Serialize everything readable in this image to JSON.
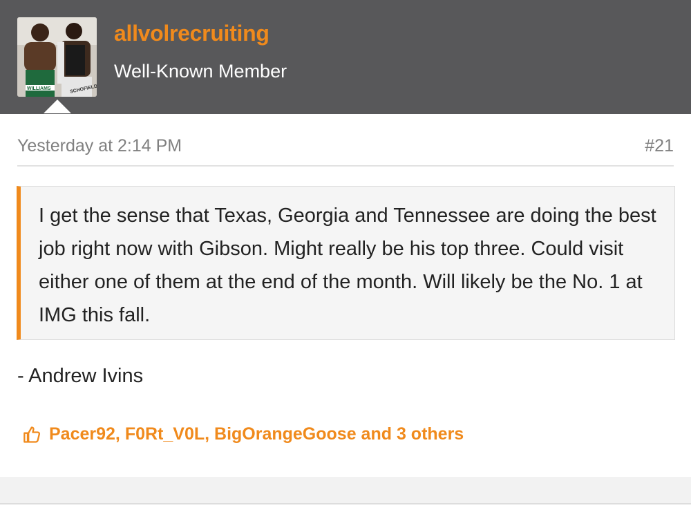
{
  "user": {
    "name": "allvolrecruiting",
    "title": "Well-Known Member",
    "avatar_jersey_left": "WILLIAMS",
    "avatar_jersey_right": "SCHOFIELD"
  },
  "post": {
    "timestamp": "Yesterday at 2:14 PM",
    "number": "#21",
    "quote": "I get the sense that Texas, Georgia and Tennessee are doing the best job right now with Gibson. Might really be his top three. Could visit either one of them at the end of the month. Will likely be the No. 1 at IMG this fall.",
    "signature": "- Andrew Ivins"
  },
  "reactions": {
    "icon": "thumbs-up-icon",
    "text": "Pacer92, F0Rt_V0L, BigOrangeGoose and 3 others"
  },
  "colors": {
    "accent": "#f08a1c",
    "header_bg": "#58585a",
    "meta_text": "#808080",
    "quote_bg": "#f5f5f5"
  }
}
